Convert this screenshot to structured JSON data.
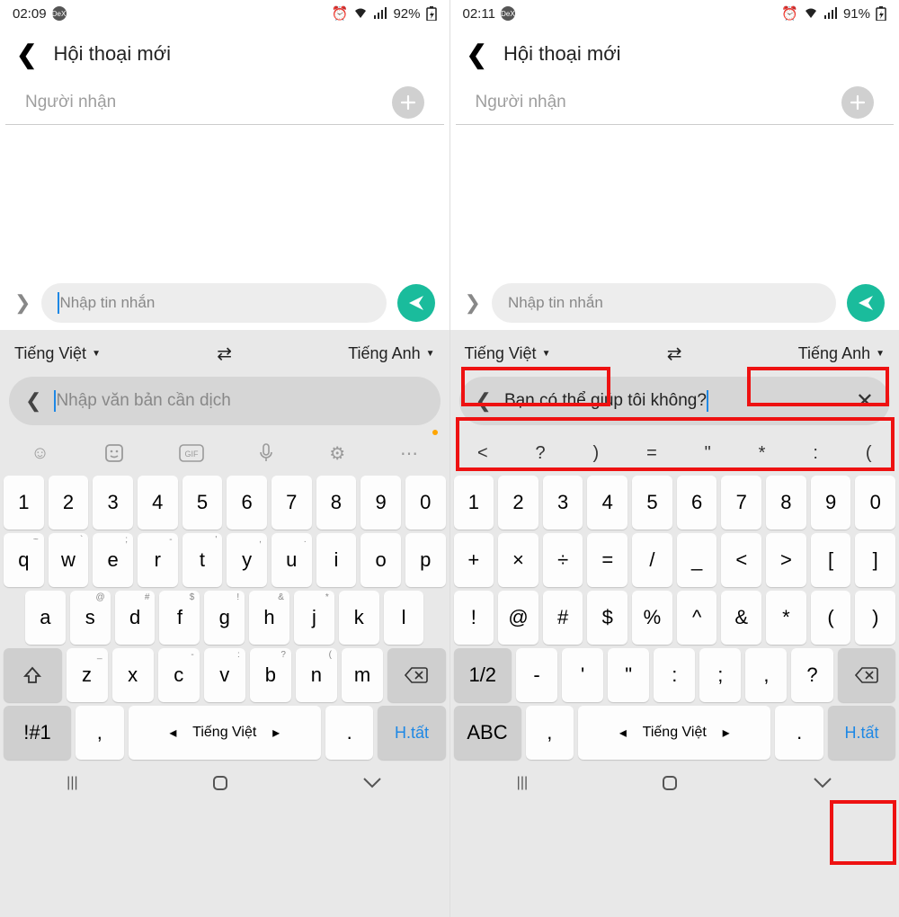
{
  "left": {
    "status": {
      "time": "02:09",
      "dex": "DeX",
      "battery": "92%"
    },
    "header": {
      "title": "Hội thoại mới"
    },
    "recipient_placeholder": "Người nhận",
    "message_placeholder": "Nhập tin nhắn",
    "trans": {
      "src": "Tiếng Việt",
      "dst": "Tiếng Anh"
    },
    "trans_input_placeholder": "Nhập văn bản cần dịch",
    "kb": {
      "row1": [
        "1",
        "2",
        "3",
        "4",
        "5",
        "6",
        "7",
        "8",
        "9",
        "0"
      ],
      "row2": [
        "q",
        "w",
        "e",
        "r",
        "t",
        "y",
        "u",
        "i",
        "o",
        "p"
      ],
      "row2sup": [
        "~",
        "`",
        ";",
        "-",
        "'",
        ",",
        ".",
        "",
        "",
        ""
      ],
      "row3": [
        "a",
        "s",
        "d",
        "f",
        "g",
        "h",
        "j",
        "k",
        "l"
      ],
      "row3sup": [
        "",
        "@",
        "#",
        "$",
        "!",
        "&",
        "*",
        "",
        ""
      ],
      "row4": [
        "z",
        "x",
        "c",
        "v",
        "b",
        "n",
        "m"
      ],
      "row4sup": [
        "_",
        "",
        "-",
        ":",
        "?",
        "(",
        ""
      ],
      "mode": "!#1",
      "comma": ",",
      "space": "Tiếng Việt",
      "period": ".",
      "done": "H.tất"
    }
  },
  "right": {
    "status": {
      "time": "02:11",
      "dex": "DeX",
      "battery": "91%"
    },
    "header": {
      "title": "Hội thoại mới"
    },
    "recipient_placeholder": "Người nhận",
    "message_placeholder": "Nhập tin nhắn",
    "trans": {
      "src": "Tiếng Việt",
      "dst": "Tiếng Anh"
    },
    "trans_input_value": "Bạn có thể giúp tôi không?",
    "symrow": [
      "<",
      "?",
      ")",
      "=",
      "\"",
      "*",
      ":",
      "("
    ],
    "kb": {
      "row1": [
        "1",
        "2",
        "3",
        "4",
        "5",
        "6",
        "7",
        "8",
        "9",
        "0"
      ],
      "row2": [
        "+",
        "×",
        "÷",
        "=",
        "/",
        "_",
        "<",
        ">",
        "[",
        "]"
      ],
      "row3": [
        "!",
        "@",
        "#",
        "$",
        "%",
        "^",
        "&",
        "*",
        "(",
        ")"
      ],
      "row4": [
        "-",
        "'",
        "\"",
        ":",
        ";",
        ",",
        "?"
      ],
      "page": "1/2",
      "mode": "ABC",
      "comma": ",",
      "space": "Tiếng Việt",
      "period": ".",
      "done": "H.tất"
    }
  }
}
